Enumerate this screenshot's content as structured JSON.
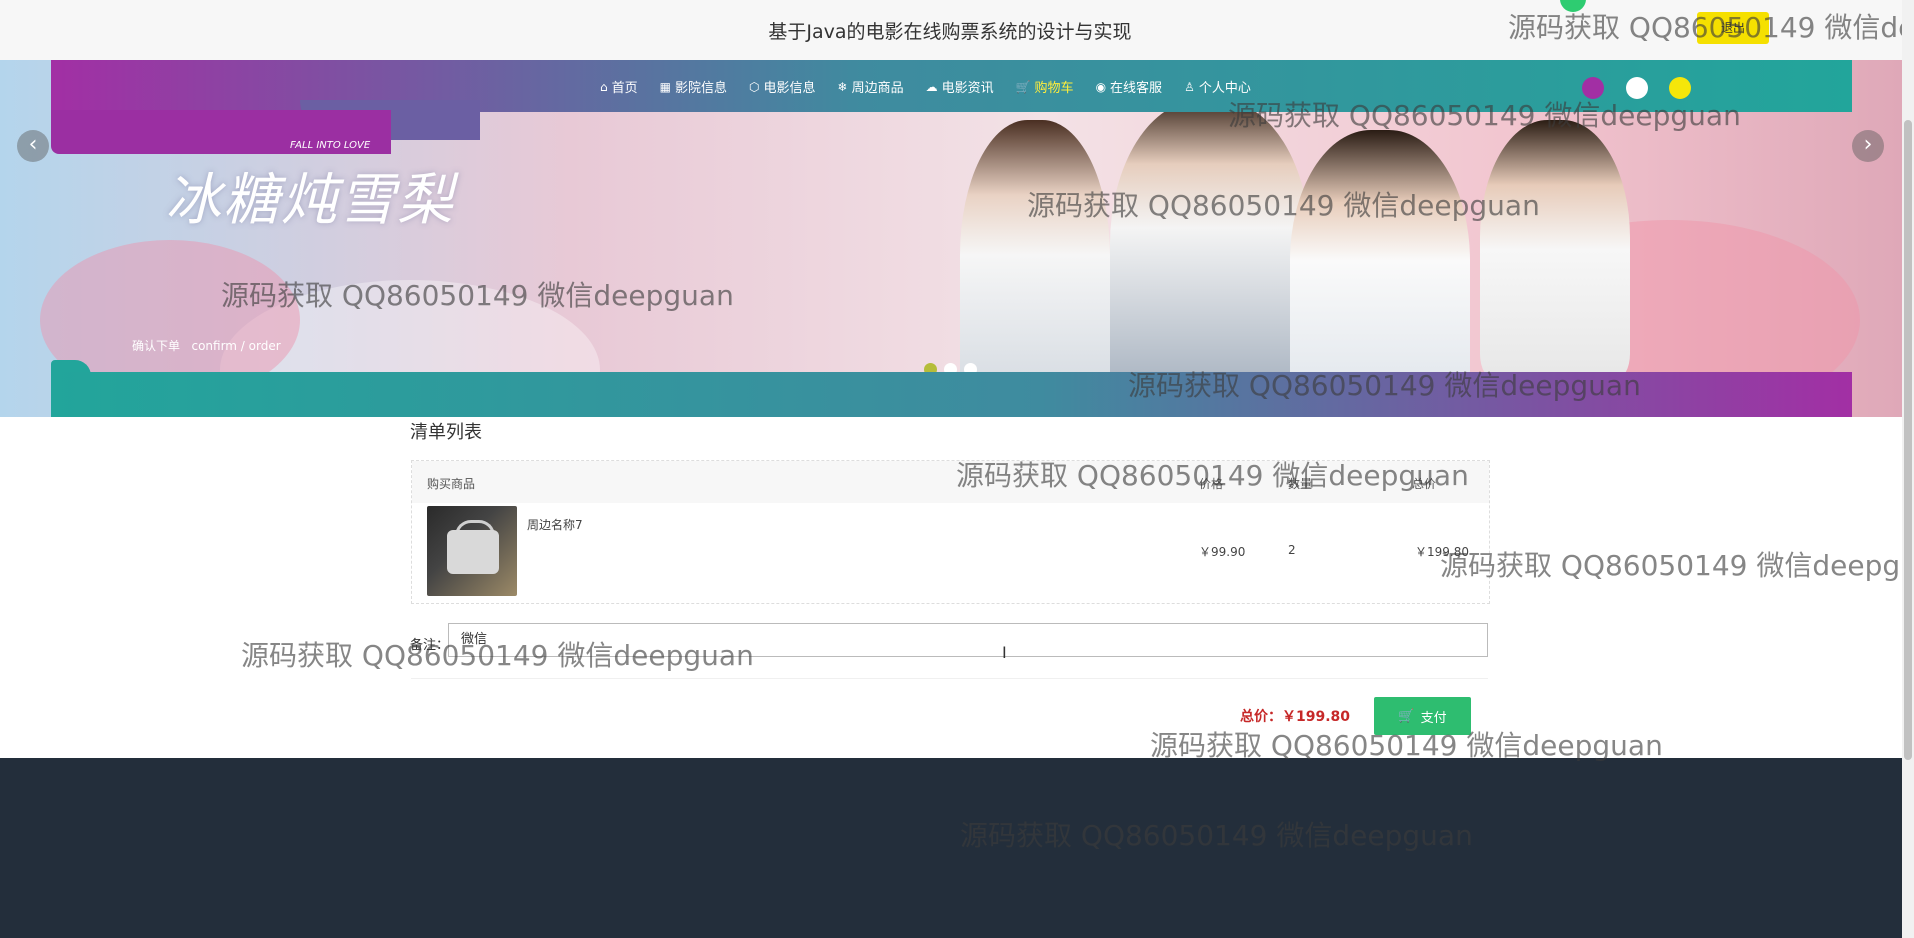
{
  "header": {
    "title": "基于Java的电影在线购票系统的设计与实现",
    "logout_label": "退出"
  },
  "nav": {
    "items": [
      {
        "label": "首页",
        "icon": "home-icon",
        "glyph": "⌂"
      },
      {
        "label": "影院信息",
        "icon": "cinema-icon",
        "glyph": "▦"
      },
      {
        "label": "电影信息",
        "icon": "cube-icon",
        "glyph": "⬡"
      },
      {
        "label": "周边商品",
        "icon": "snowflake-icon",
        "glyph": "❄"
      },
      {
        "label": "电影资讯",
        "icon": "palette-icon",
        "glyph": "☁"
      },
      {
        "label": "购物车",
        "icon": "cart-icon",
        "glyph": "🛒",
        "active": true
      },
      {
        "label": "在线客服",
        "icon": "support-icon",
        "glyph": "◉"
      },
      {
        "label": "个人中心",
        "icon": "user-icon",
        "glyph": "♙"
      }
    ],
    "theme_colors": [
      "#a22fa4",
      "#ffffff",
      "#f5e60a"
    ]
  },
  "banner": {
    "title_art": "冰糖炖雪梨",
    "subtitle_art": "FALL INTO LOVE",
    "slides": 3,
    "active_slide": 1
  },
  "breadcrumb": {
    "label_cn": "确认下单",
    "label_en": "confirm / order"
  },
  "order": {
    "list_title": "清单列表",
    "columns": [
      "购买商品",
      "价格",
      "数量",
      "总价"
    ],
    "items": [
      {
        "name": "周边名称7",
        "price": "￥99.90",
        "qty": "2",
        "total": "￥199.80"
      }
    ],
    "remark_label": "备注：",
    "remark_value": "微信",
    "total_label": "总价：",
    "total_value": "￥199.80",
    "pay_label": "支付"
  },
  "watermark": "源码获取 QQ86050149 微信deepguan"
}
